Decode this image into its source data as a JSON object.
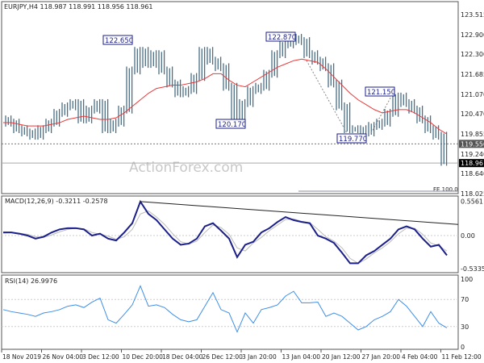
{
  "header": {
    "symbol_title": "EURJPY,H4  118.987 118.991 118.956 118.961"
  },
  "watermark": "ActionForex.com",
  "colors": {
    "bars": "#4a6f86",
    "ma": "#e8393a",
    "macd": "#1b1f8a",
    "signal": "#bbbbbb",
    "rsi": "#3d8ee8",
    "label_border": "#1b1f8a"
  },
  "chart_data": [
    {
      "type": "bar",
      "panel": "price",
      "title": "EURJPY,H4  118.987 118.991 118.956 118.961",
      "yticks": [
        "123.515",
        "122.900",
        "122.300",
        "121.685",
        "121.070",
        "120.470",
        "119.855",
        "119.550",
        "119.240",
        "118.961",
        "118.640",
        "118.025"
      ],
      "ylim": [
        118.025,
        123.515
      ],
      "close": [
        120.3,
        120.2,
        120.0,
        119.9,
        119.8,
        120.0,
        120.2,
        120.5,
        120.7,
        120.8,
        120.3,
        120.6,
        120.8,
        120.0,
        120.2,
        120.6,
        121.8,
        122.4,
        122.0,
        122.3,
        121.8,
        121.4,
        121.1,
        121.2,
        121.6,
        122.4,
        122.1,
        121.9,
        121.3,
        120.3,
        120.8,
        121.2,
        121.3,
        121.7,
        122.3,
        122.6,
        122.8,
        122.7,
        122.3,
        122.1,
        121.9,
        121.4,
        120.7,
        120.0,
        120.0,
        119.9,
        120.1,
        120.2,
        120.5,
        121.0,
        120.8,
        120.6,
        120.3,
        120.0,
        119.8,
        119.0
      ],
      "ma": [
        120.2,
        120.2,
        120.15,
        120.1,
        120.1,
        120.1,
        120.15,
        120.2,
        120.3,
        120.35,
        120.4,
        120.35,
        120.3,
        120.3,
        120.35,
        120.5,
        120.7,
        120.9,
        121.1,
        121.25,
        121.3,
        121.35,
        121.35,
        121.4,
        121.45,
        121.55,
        121.7,
        121.7,
        121.5,
        121.35,
        121.3,
        121.45,
        121.6,
        121.75,
        121.9,
        122.0,
        122.1,
        122.15,
        122.1,
        122.05,
        121.85,
        121.6,
        121.35,
        121.1,
        120.9,
        120.75,
        120.6,
        120.5,
        120.55,
        120.6,
        120.6,
        120.5,
        120.35,
        120.2,
        120.0,
        119.85
      ],
      "price_labels": [
        "122.650",
        "122.870",
        "120.170",
        "119.770",
        "121.150"
      ],
      "levels": {
        "dotted": "119.550",
        "current": "118.961"
      },
      "fe_label": "FE 100.0"
    },
    {
      "type": "line",
      "panel": "macd",
      "title": "MACD(12,26,9) -0.3211 -0.2578",
      "yticks": [
        "0.5561",
        "0.00",
        "-0.5335"
      ],
      "ylim": [
        -0.5335,
        0.5561
      ],
      "macd": [
        0.05,
        0.05,
        0.03,
        0.0,
        -0.05,
        -0.02,
        0.05,
        0.1,
        0.12,
        0.12,
        0.1,
        0.0,
        0.03,
        -0.05,
        -0.08,
        0.05,
        0.2,
        0.55,
        0.35,
        0.25,
        0.1,
        -0.05,
        -0.15,
        -0.13,
        -0.05,
        0.15,
        0.2,
        0.08,
        -0.05,
        -0.35,
        -0.15,
        -0.1,
        0.05,
        0.12,
        0.22,
        0.3,
        0.25,
        0.22,
        0.2,
        0.0,
        -0.05,
        -0.12,
        -0.28,
        -0.45,
        -0.45,
        -0.32,
        -0.25,
        -0.15,
        -0.05,
        0.1,
        0.15,
        0.1,
        -0.05,
        -0.18,
        -0.15,
        -0.32
      ],
      "signal": [
        0.04,
        0.05,
        0.04,
        0.02,
        -0.02,
        -0.03,
        0.01,
        0.06,
        0.1,
        0.12,
        0.11,
        0.05,
        0.02,
        -0.01,
        -0.06,
        -0.02,
        0.1,
        0.35,
        0.4,
        0.3,
        0.18,
        0.03,
        -0.1,
        -0.14,
        -0.09,
        0.05,
        0.17,
        0.13,
        0.02,
        -0.2,
        -0.25,
        -0.12,
        -0.03,
        0.08,
        0.17,
        0.26,
        0.27,
        0.23,
        0.21,
        0.1,
        -0.02,
        -0.09,
        -0.2,
        -0.37,
        -0.45,
        -0.38,
        -0.28,
        -0.2,
        -0.1,
        0.03,
        0.12,
        0.12,
        0.02,
        -0.12,
        -0.17,
        -0.25
      ],
      "trendline": [
        0.55,
        0.18
      ]
    },
    {
      "type": "line",
      "panel": "rsi",
      "title": "RSI(14) 26.9976",
      "yticks": [
        "100",
        "70",
        "30",
        "0"
      ],
      "ylim": [
        0,
        100
      ],
      "rsi": [
        55,
        52,
        50,
        48,
        45,
        50,
        52,
        55,
        60,
        62,
        58,
        66,
        72,
        40,
        35,
        48,
        62,
        90,
        60,
        62,
        58,
        48,
        40,
        37,
        40,
        60,
        80,
        55,
        50,
        22,
        50,
        35,
        55,
        58,
        62,
        75,
        82,
        65,
        65,
        66,
        45,
        50,
        45,
        35,
        25,
        30,
        40,
        45,
        52,
        70,
        60,
        45,
        30,
        52,
        35,
        28
      ]
    },
    {
      "type": "axis",
      "panel": "time",
      "xticks": [
        "18 Nov 2019",
        "26 Nov 04:00",
        "3 Dec 12:00",
        "10 Dec 20:00",
        "18 Dec 04:00",
        "26 Dec 12:00",
        "3 Jan 20:00",
        "13 Jan 04:00",
        "20 Jan 12:00",
        "27 Jan 20:00",
        "4 Feb 04:00",
        "11 Feb 12:00"
      ]
    }
  ]
}
